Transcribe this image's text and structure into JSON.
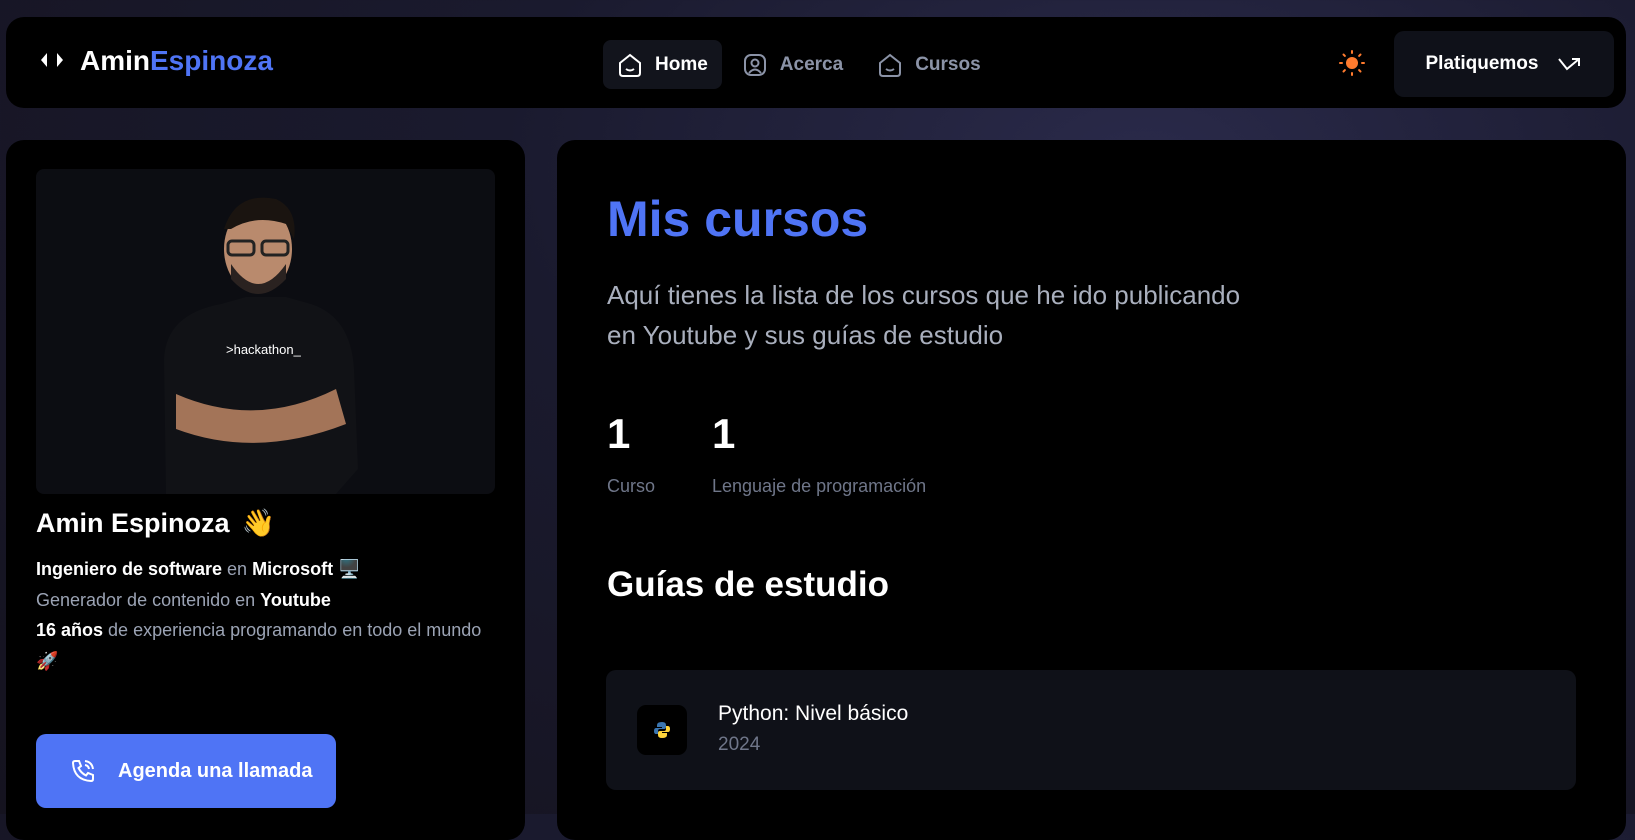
{
  "header": {
    "logo_first": "Amin",
    "logo_second": "Espinoza",
    "nav": [
      {
        "label": "Home",
        "icon": "home-icon",
        "active": true
      },
      {
        "label": "Acerca",
        "icon": "user-icon"
      },
      {
        "label": "Cursos",
        "icon": "home-icon"
      }
    ],
    "theme_icon": "sun-icon",
    "cta_label": "Platiquemos",
    "cta_icon": "arrow-up-right-icon"
  },
  "profile": {
    "name": "Amin Espinoza",
    "name_emoji": "👋",
    "bio": {
      "l1a": "Ingeniero de software",
      "l1b": " en ",
      "l1c": "Microsoft",
      "l1d": " 🖥️",
      "l2a": "Generador de contenido en ",
      "l2b": "Youtube",
      "l3a": "16 años",
      "l3b": " de experiencia programando en todo el mundo 🚀"
    },
    "call_label": "Agenda una llamada",
    "call_icon": "phone-icon"
  },
  "main": {
    "title": "Mis cursos",
    "description": "Aquí tienes la lista de los cursos que he ido publicando en Youtube y sus guías de estudio",
    "stats": [
      {
        "value": "1",
        "label": "Curso"
      },
      {
        "value": "1",
        "label": "Lenguaje de programación"
      }
    ],
    "guides_title": "Guías de estudio",
    "courses": [
      {
        "title": "Python: Nivel básico",
        "year": "2024",
        "icon": "python-icon"
      }
    ]
  },
  "colors": {
    "accent": "#4f74f5",
    "sun": "#ff7b2e",
    "panel": "#000000"
  }
}
